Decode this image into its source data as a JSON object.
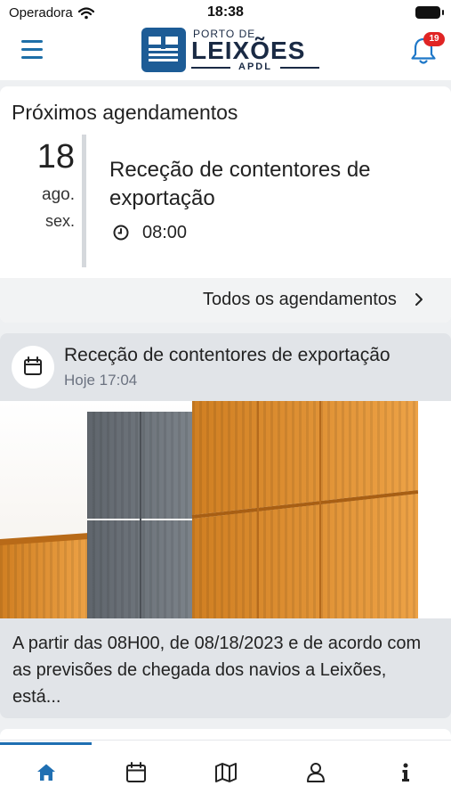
{
  "status_bar": {
    "carrier": "Operadora",
    "time": "18:38"
  },
  "header": {
    "logo_small": "PORTO DE",
    "logo_big": "LEIXÕES",
    "logo_sub": "APDL",
    "notification_count": "19",
    "icons": [
      "menu-icon",
      "bell-icon"
    ]
  },
  "upcoming": {
    "title": "Próximos agendamentos",
    "date_day": "18",
    "date_month": "ago.",
    "date_weekday": "sex.",
    "event_title": "Receção de contentores de exportação",
    "event_time": "08:00",
    "all_link_label": "Todos os agendamentos"
  },
  "news": {
    "title": "Receção de contentores de exportação",
    "date": "Hoje 17:04",
    "excerpt": "A partir das 08H00, de 08/18/2023 e de acordo com as previsões de chegada dos navios a Leixões, está..."
  },
  "tabbar": {
    "tabs": [
      "home-icon",
      "calendar-icon",
      "map-icon",
      "profile-icon",
      "info-icon"
    ],
    "active_tab": "home-icon"
  },
  "colors": {
    "accent": "#1f6fb2",
    "badge": "#e02424",
    "container_orange": "#e0922e",
    "container_gray": "#6b7178"
  }
}
